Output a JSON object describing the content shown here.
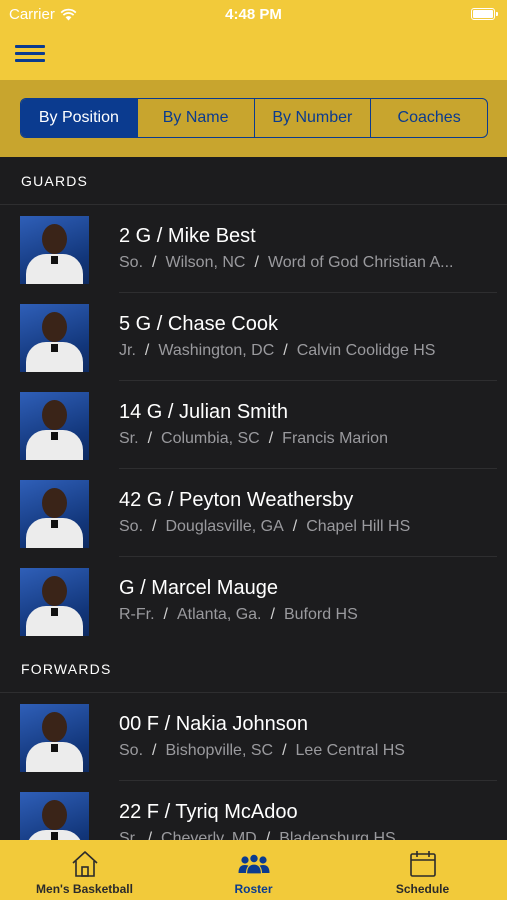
{
  "status_bar": {
    "carrier": "Carrier",
    "time": "4:48 PM"
  },
  "nav": {
    "menu_icon": "hamburger-menu-icon"
  },
  "segments": [
    {
      "label": "By Position",
      "active": true
    },
    {
      "label": "By Name",
      "active": false
    },
    {
      "label": "By Number",
      "active": false
    },
    {
      "label": "Coaches",
      "active": false
    }
  ],
  "sections": [
    {
      "title": "GUARDS",
      "players": [
        {
          "title": "2 G / Mike Best",
          "class": "So.",
          "hometown": "Wilson, NC",
          "school": "Word of God Christian A..."
        },
        {
          "title": "5 G / Chase Cook",
          "class": "Jr.",
          "hometown": "Washington, DC",
          "school": "Calvin Coolidge HS"
        },
        {
          "title": "14 G / Julian Smith",
          "class": "Sr.",
          "hometown": "Columbia, SC",
          "school": "Francis Marion"
        },
        {
          "title": "42 G / Peyton Weathersby",
          "class": "So.",
          "hometown": "Douglasville, GA",
          "school": "Chapel Hill HS"
        },
        {
          "title": "G / Marcel Mauge",
          "class": "R-Fr.",
          "hometown": "Atlanta, Ga.",
          "school": "Buford HS"
        }
      ]
    },
    {
      "title": "FORWARDS",
      "players": [
        {
          "title": "00 F / Nakia Johnson",
          "class": "So.",
          "hometown": "Bishopville, SC",
          "school": "Lee Central HS"
        },
        {
          "title": "22 F / Tyriq McAdoo",
          "class": "Sr.",
          "hometown": "Cheverly, MD",
          "school": "Bladensburg HS"
        }
      ]
    }
  ],
  "tabs": [
    {
      "label": "Men's Basketball",
      "icon": "home-icon",
      "active": false
    },
    {
      "label": "Roster",
      "icon": "people-icon",
      "active": true
    },
    {
      "label": "Schedule",
      "icon": "calendar-icon",
      "active": false
    }
  ],
  "colors": {
    "gold": "#f2ca3a",
    "dark_gold": "#c8a52e",
    "navy": "#0b3b8f",
    "background": "#1c1c1e"
  }
}
